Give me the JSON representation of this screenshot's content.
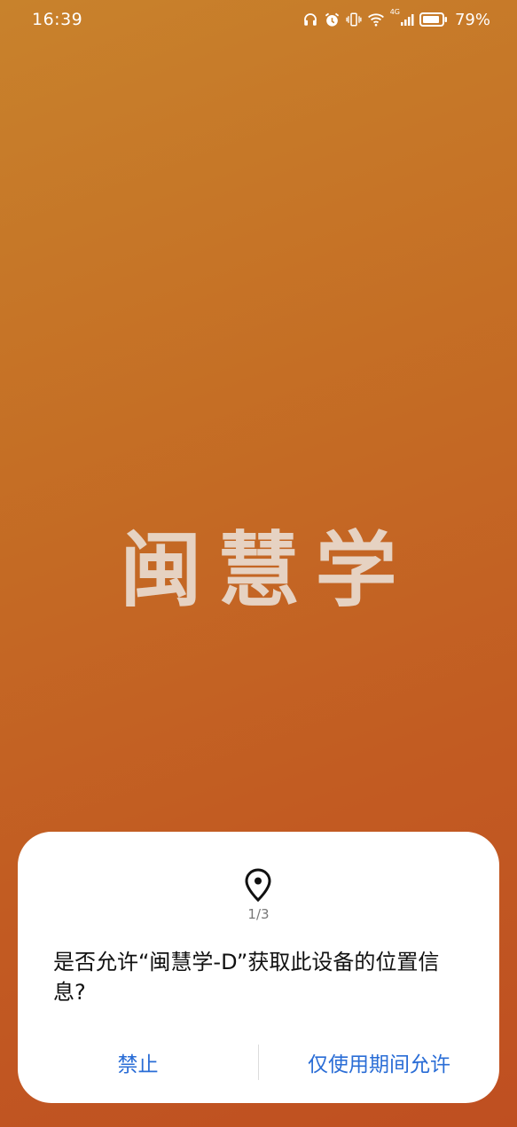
{
  "status_bar": {
    "time": "16:39",
    "icons": [
      "headphones-icon",
      "alarm-icon",
      "vibrate-icon",
      "wifi-icon",
      "signal-4g-icon",
      "battery-icon"
    ],
    "network_label": "4G",
    "battery_percent": "79%"
  },
  "splash": {
    "app_name": "闽慧学"
  },
  "dialog": {
    "icon": "location-pin-icon",
    "pager": "1/3",
    "message": "是否允许“闽慧学-D”获取此设备的位置信息?",
    "deny_label": "禁止",
    "allow_label": "仅使用期间允许"
  },
  "colors": {
    "background_top": "#c8822c",
    "background_bottom": "#bf4f21",
    "button_text": "#2a6dd6",
    "dialog_bg": "#ffffff"
  }
}
